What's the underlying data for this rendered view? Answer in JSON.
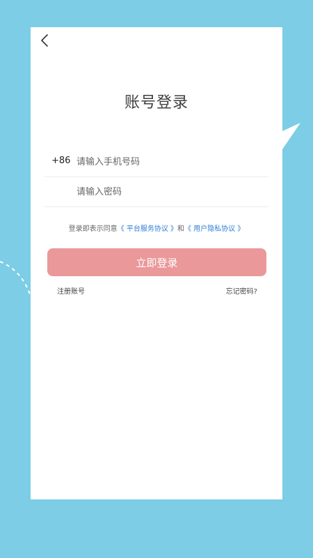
{
  "colors": {
    "background": "#7ccde5",
    "card": "#ffffff",
    "accent_button": "#ea989a",
    "link": "#2f7fd4"
  },
  "header": {
    "back_icon": "chevron-left-icon",
    "title": "账号登录"
  },
  "form": {
    "phone": {
      "prefix": "+86",
      "placeholder": "请输入手机号码",
      "value": ""
    },
    "password": {
      "placeholder": "请输入密码",
      "value": ""
    }
  },
  "agreement": {
    "text": "登录即表示同意",
    "service_link": "《 平台服务协议 》",
    "connector": "和",
    "privacy_link": "《 用户隐私协议 》"
  },
  "login_button": "立即登录",
  "footer": {
    "register": "注册账号",
    "forgot": "忘记密码?"
  },
  "decor": {
    "icons": [
      "paper-plane-icon",
      "dashed-path-decoration"
    ]
  }
}
